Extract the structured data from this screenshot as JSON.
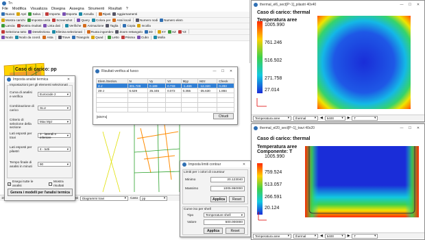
{
  "main": {
    "title": "Tn",
    "menu": [
      "File",
      "Modifica",
      "Visualizza",
      "Disegna",
      "Assegna",
      "Strumenti",
      "Risultati",
      "?"
    ],
    "toolbar1": [
      "Nuovo",
      "Apri",
      "Salva",
      "Importa",
      "Esporta",
      "Annulla",
      "Ripeti",
      "Aggiornamenti"
    ],
    "toolbar2": [
      "Mostra carichi",
      "Imposta unità",
      "Screenshot",
      "Query",
      "Colora per",
      "Assi locali",
      "Numero nodi",
      "Numero elem"
    ],
    "toolbar3": [
      "Lancia",
      "Mostra risultati",
      "Lista dati",
      "Verifiche",
      "Animazione",
      "Taglia",
      "Copia",
      "Incolla"
    ],
    "toolbar4": [
      "Seleziona tutto",
      "Deseleziona",
      "Elimina selezionati",
      "Ruota ingombro",
      "Zoom rettangolo",
      "3D",
      "XY",
      "XZ",
      "YZ"
    ],
    "toolbar5": [
      "Nodo",
      "Nodo da coord.",
      "Asta",
      "Trave",
      "Triangolo",
      "Quad",
      "Letto",
      "Prisma",
      "Cubo",
      "Molla"
    ],
    "canvas_label": "Caso di carico: pp",
    "status": {
      "nodes": "198 nodi",
      "elements": "300 elementi",
      "results_label": "Risultati",
      "results_value": "Diagrammi travi",
      "case_label": "Caso",
      "case_value": "pp"
    }
  },
  "thermal_dialog": {
    "title": "Imposta analisi termica",
    "group": "Impostazioni per gli elementi selezionati",
    "fields": [
      {
        "label": "Curva di analisi e verifica",
        "value": "Eurocode 2"
      },
      {
        "label": "Combinazione di carico",
        "value": "SLU"
      },
      {
        "label": "Criterio di selezione della sezione",
        "value": "Max Myz"
      },
      {
        "label": "Lati esposti per travi",
        "value": "3 - laterali e inferiore"
      },
      {
        "label": "Lati esposti per pilastri",
        "value": "4 - tutti"
      },
      {
        "label": "Tempo finale di analisi in minuti",
        "value": "90"
      }
    ],
    "check1": "Esegui tutte le analisi",
    "check2": "Mostra risultati",
    "button": "Genera i modelli per l'analisi termica"
  },
  "results_dialog": {
    "title": "Risultati verifica al fuoco",
    "columns": [
      "Elem./Sezion.",
      "N",
      "Vy",
      "Vz",
      "Myy",
      "Mzz",
      "Check"
    ],
    "rows": [
      [
        "4-J",
        "301.728",
        "0.189",
        "0.733",
        "-1.466",
        "-12.320",
        "0.283"
      ],
      [
        "28-J",
        "6.629",
        "35.345",
        "0.072",
        "0.355",
        "-35.630",
        "1.884"
      ]
    ],
    "footer_count": "[6/67m]",
    "close": "Chiudi"
  },
  "contour_dialog": {
    "title": "Imposta limiti contour",
    "group1": "Limiti per i colori di countour",
    "min_label": "Minimo",
    "min_value": "20.123040",
    "max_label": "Massimo",
    "max_value": "1005.950000",
    "apply": "Applica",
    "reset": "Reset",
    "group2": "Curve iso per shell",
    "type_label": "Tipo",
    "type_value": "Temperature shell",
    "value_label": "Valore",
    "value_value": "500.000000",
    "apply2": "Applica",
    "reset2": "Reset"
  },
  "thermal_window_1": {
    "title": "thermal_el6_sect[P~1]_pilastri 40x40",
    "case": "Caso di carico: thermal",
    "legend_title": "Temperatura aree",
    "legend_values": [
      "1005.990",
      "761.246",
      "516.502",
      "271.758",
      "27.014"
    ],
    "bottom_label": "Temperatura aree",
    "bottom_type": "thermal",
    "bottom_step": "5400",
    "bottom_var": "T",
    "colors": {
      "hot": "#ff2a00",
      "cold": "#1a2dd8"
    }
  },
  "thermal_window_2": {
    "title": "thermal_el20_sect[P~1]_travi 40x20",
    "case": "Caso di carico: thermal",
    "legend_title": "Temperatura aree",
    "legend_sub": "Componente: T",
    "legend_values": [
      "1005.990",
      "759.524",
      "513.057",
      "266.591",
      "20.124"
    ],
    "bottom_label": "Temperatura aree",
    "bottom_type": "thermal",
    "bottom_step": "5400",
    "bottom_var": "T"
  }
}
